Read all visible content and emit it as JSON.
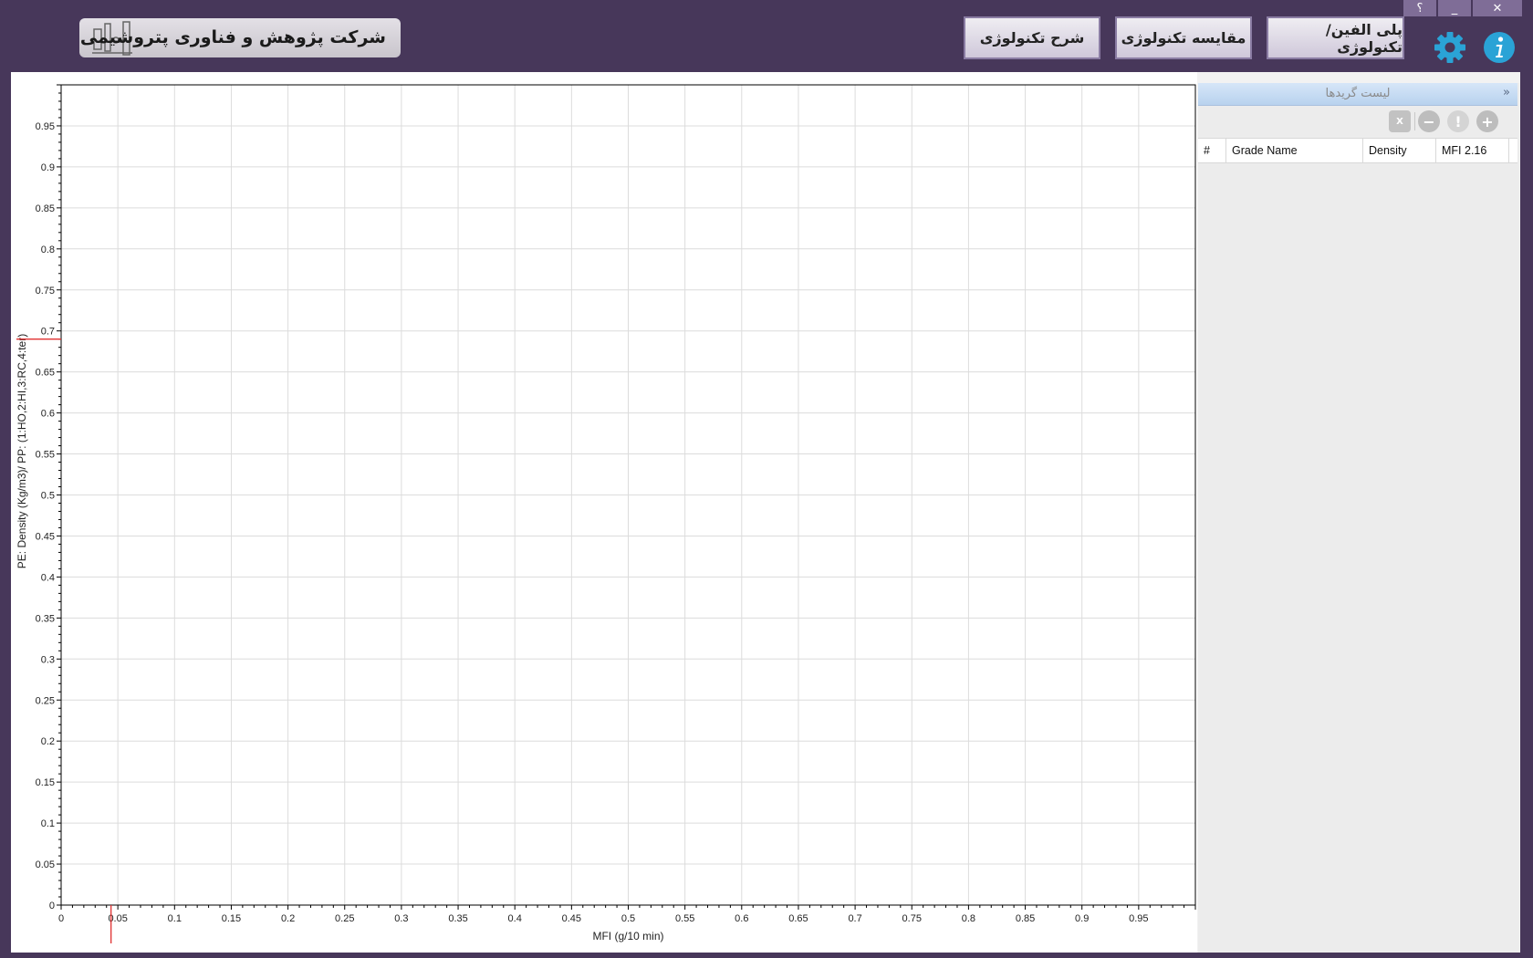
{
  "window": {
    "help_label": "؟",
    "minimize_label": "_",
    "close_label": "✕"
  },
  "header": {
    "company_name": "شرکت پژوهش و فناوری پتروشیمی",
    "buttons": [
      "پلی الفین/تکنولوژی",
      "مقایسه تکنولوژی",
      "شرح تکنولوژی"
    ]
  },
  "icons": {
    "settings": "gear-icon",
    "info": "info-icon",
    "logo": "company-logo"
  },
  "colors": {
    "background": "#47375a",
    "accent": "#2aa3d6",
    "marker": "#e03030"
  },
  "grade_panel": {
    "title": "لیست گریدها",
    "collapse_label": "»",
    "toolbar": {
      "excel_label": "X",
      "remove_label": "−",
      "alert_label": "!",
      "add_label": "+"
    },
    "columns": [
      "#",
      "Grade Name",
      "Density",
      "MFI 2.16"
    ],
    "rows": []
  },
  "chart_data": {
    "type": "scatter",
    "xlabel": "MFI (g/10 min)",
    "ylabel": "PE: Density (Kg/m3)/ PP: (1:HO,2:HI,3:RC,4:ter)",
    "xlim": [
      0,
      1
    ],
    "ylim": [
      0,
      1
    ],
    "x_ticks": [
      "0",
      "0.05",
      "0.1",
      "0.15",
      "0.2",
      "0.25",
      "0.3",
      "0.35",
      "0.4",
      "0.45",
      "0.5",
      "0.55",
      "0.6",
      "0.65",
      "0.7",
      "0.75",
      "0.8",
      "0.85",
      "0.9",
      "0.95"
    ],
    "y_ticks": [
      "0",
      "0.05",
      "0.1",
      "0.15",
      "0.2",
      "0.25",
      "0.3",
      "0.35",
      "0.4",
      "0.45",
      "0.5",
      "0.55",
      "0.6",
      "0.65",
      "0.7",
      "0.75",
      "0.8",
      "0.85",
      "0.9",
      "0.95"
    ],
    "grid": true,
    "cursor": {
      "x": 0.044,
      "y": 0.69
    },
    "series": []
  }
}
